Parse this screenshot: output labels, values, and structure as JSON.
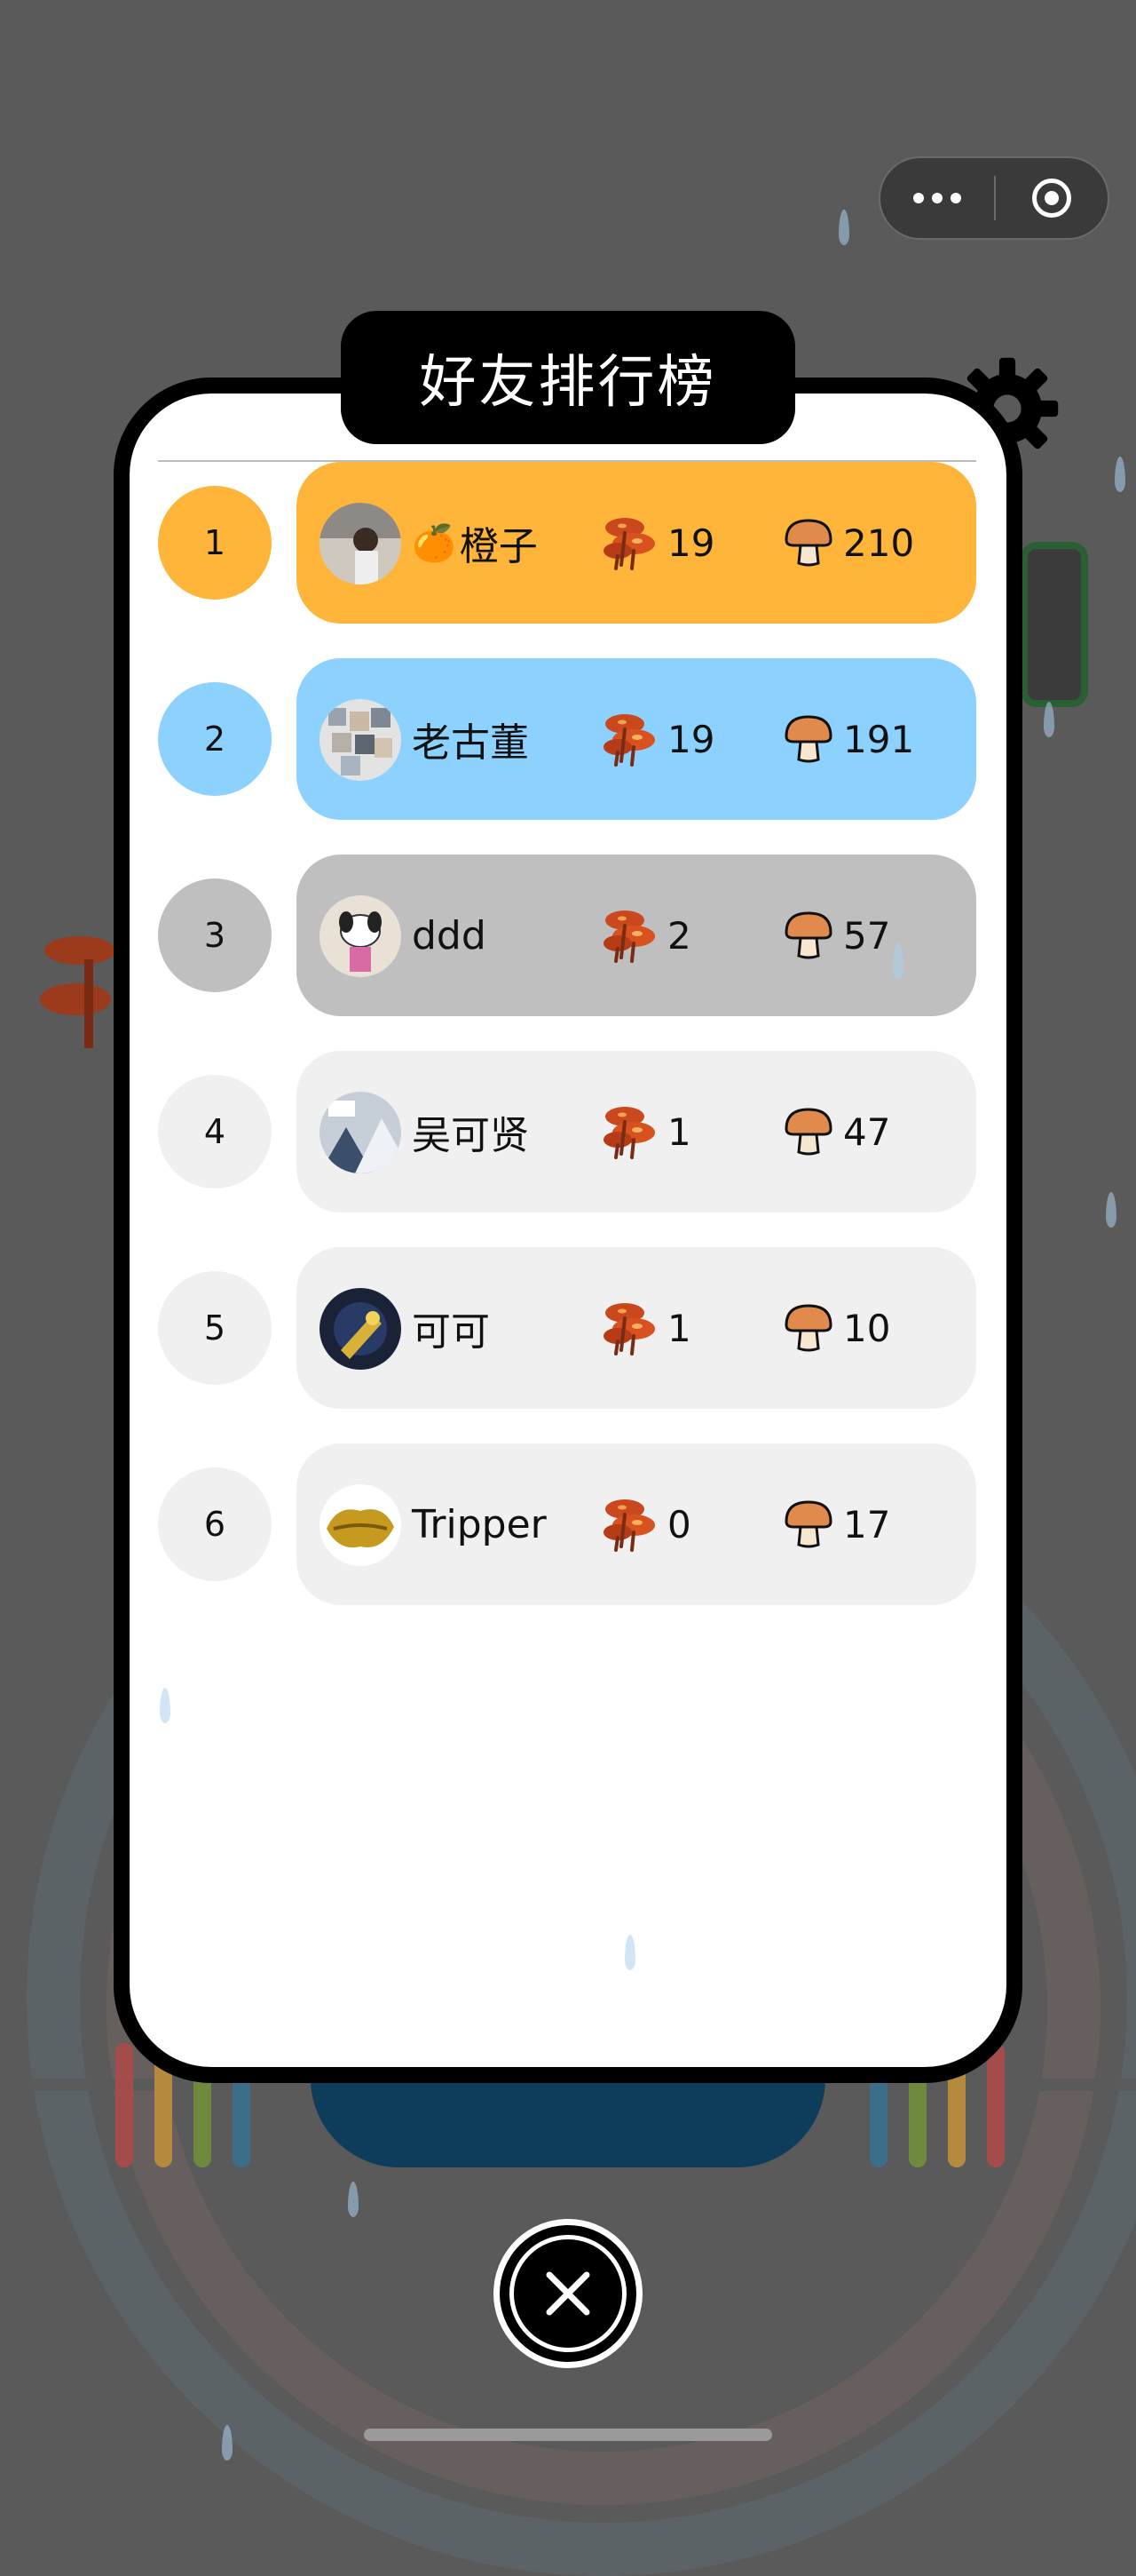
{
  "header": {
    "title": "好友排行榜",
    "capsule": {
      "more_icon": "more-dots-icon",
      "close_icon": "target-icon"
    },
    "settings_icon": "gear-icon"
  },
  "colors": {
    "rank1": "#FFB53A",
    "rank2": "#8DD2FF",
    "rank3": "#BFBFBF",
    "other": "#F0F0F0"
  },
  "leaderboard": {
    "rows": [
      {
        "rank": "1",
        "name": "橙子",
        "prefix_emoji": "🍊",
        "red_mushroom": "19",
        "brown_mushroom": "210",
        "color": "#FFB53A",
        "rank_color": "#FFB53A"
      },
      {
        "rank": "2",
        "name": "老古董",
        "prefix_emoji": "",
        "red_mushroom": "19",
        "brown_mushroom": "191",
        "color": "#8DD2FF",
        "rank_color": "#8DD2FF"
      },
      {
        "rank": "3",
        "name": "ddd",
        "prefix_emoji": "",
        "red_mushroom": "2",
        "brown_mushroom": "57",
        "color": "#BFBFBF",
        "rank_color": "#BFBFBF"
      },
      {
        "rank": "4",
        "name": "吴可贤",
        "prefix_emoji": "",
        "red_mushroom": "1",
        "brown_mushroom": "47",
        "color": "#F0F0F0",
        "rank_color": "#F0F0F0"
      },
      {
        "rank": "5",
        "name": "可可",
        "prefix_emoji": "",
        "red_mushroom": "1",
        "brown_mushroom": "10",
        "color": "#F0F0F0",
        "rank_color": "#F0F0F0"
      },
      {
        "rank": "6",
        "name": "Tripper",
        "prefix_emoji": "",
        "red_mushroom": "0",
        "brown_mushroom": "17",
        "color": "#F0F0F0",
        "rank_color": "#F0F0F0"
      }
    ]
  },
  "footer": {
    "close_icon": "close-icon"
  }
}
